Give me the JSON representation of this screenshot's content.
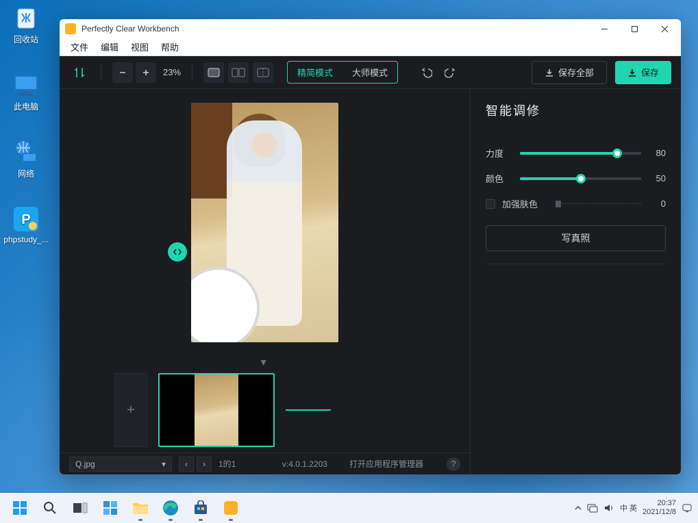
{
  "desktop": {
    "recycle": "回收站",
    "this_pc": "此电脑",
    "network": "网络",
    "phpstudy": "phpstudy_..."
  },
  "window": {
    "title": "Perfectly Clear Workbench"
  },
  "menus": {
    "file": "文件",
    "edit": "编辑",
    "view": "视图",
    "help": "帮助"
  },
  "toolbar": {
    "zoom_pct": "23%",
    "mode_simple": "精简模式",
    "mode_master": "大师模式",
    "save_all": "保存全部",
    "save": "保存"
  },
  "panel": {
    "title": "智能调修",
    "strength": {
      "label": "力度",
      "value": "80",
      "pct": 80
    },
    "color": {
      "label": "颜色",
      "value": "50",
      "pct": 50
    },
    "skin": {
      "label": "加强肤色",
      "value": "0"
    },
    "portrait_btn": "写真照"
  },
  "footer": {
    "file_name": "Q.jpg",
    "page_info": "1的1",
    "version": "v:4.0.1.2203",
    "open_mgr": "打开应用程序管理器"
  },
  "tray": {
    "lang": "中 英",
    "time": "20:37",
    "date": "2021/12/8"
  }
}
